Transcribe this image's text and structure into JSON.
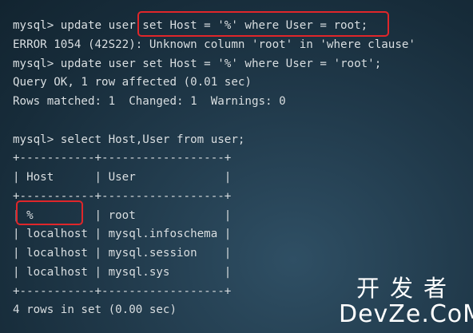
{
  "terminal": {
    "lines": [
      "mysql> update user set Host = '%' where User = root;",
      "ERROR 1054 (42S22): Unknown column 'root' in 'where clause'",
      "mysql> update user set Host = '%' where User = 'root';",
      "Query OK, 1 row affected (0.01 sec)",
      "Rows matched: 1  Changed: 1  Warnings: 0",
      "",
      "mysql> select Host,User from user;",
      "+-----------+------------------+",
      "| Host      | User             |",
      "+-----------+------------------+",
      "| %         | root             |",
      "| localhost | mysql.infoschema |",
      "| localhost | mysql.session    |",
      "| localhost | mysql.sys        |",
      "+-----------+------------------+",
      "4 rows in set (0.00 sec)"
    ]
  },
  "watermark": {
    "chinese": "开发者",
    "english": "DevZe.CoM"
  },
  "colors": {
    "terminal_text": "#d9e0e4",
    "highlight_border": "#e0262a",
    "background": "#1e3747"
  }
}
